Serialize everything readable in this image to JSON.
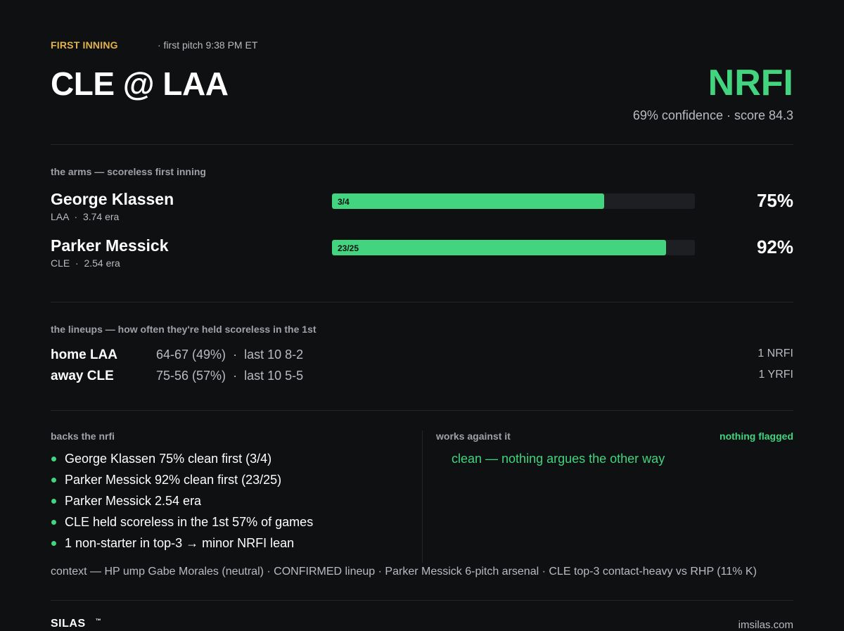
{
  "header": {
    "tag": "FIRST INNING",
    "first_pitch": "· first pitch 9:38 PM ET",
    "matchup": "CLE @ LAA",
    "verdict": "NRFI",
    "verdict_sub": "69% confidence · score 84.3"
  },
  "arms": {
    "label": "the arms — scoreless first inning",
    "pitchers": [
      {
        "name": "George Klassen",
        "team": "LAA",
        "era": "3.74 era",
        "fraction": "3/4",
        "pct": "75%",
        "value": 0.75
      },
      {
        "name": "Parker Messick",
        "team": "CLE",
        "era": "2.54 era",
        "fraction": "23/25",
        "pct": "92%",
        "value": 0.92
      }
    ]
  },
  "lineups": {
    "label": "the lineups — how often they're held scoreless in the 1st",
    "rows": [
      {
        "side": "home LAA",
        "record": "64-67 (49%)",
        "last10_label": "last 10",
        "last10": "8-2",
        "lean": "1 NRFI"
      },
      {
        "side": "away CLE",
        "record": "75-56 (57%)",
        "last10_label": "last 10",
        "last10": "5-5",
        "lean": "1 YRFI"
      }
    ]
  },
  "backs": {
    "label": "backs the nrfi",
    "items": [
      "George Klassen 75% clean first (3/4)",
      "Parker Messick 92% clean first (23/25)",
      "Parker Messick 2.54 era",
      "CLE held scoreless in the 1st 57% of games",
      "1 non-starter in top-3 → minor NRFI lean"
    ]
  },
  "against": {
    "label": "works against it",
    "flag": "nothing flagged",
    "text": "clean — nothing argues the other way"
  },
  "context": "context — HP ump Gabe Morales (neutral)  ·  CONFIRMED lineup  ·  Parker Messick 6-pitch arsenal  ·  CLE top-3 contact-heavy vs RHP (11% K)",
  "footer": {
    "brand": "SILAS",
    "tm": "™",
    "site": "imsilas.com"
  },
  "colors": {
    "accent": "#42d47f",
    "tag": "#e2b24a",
    "background": "#0f1012"
  }
}
